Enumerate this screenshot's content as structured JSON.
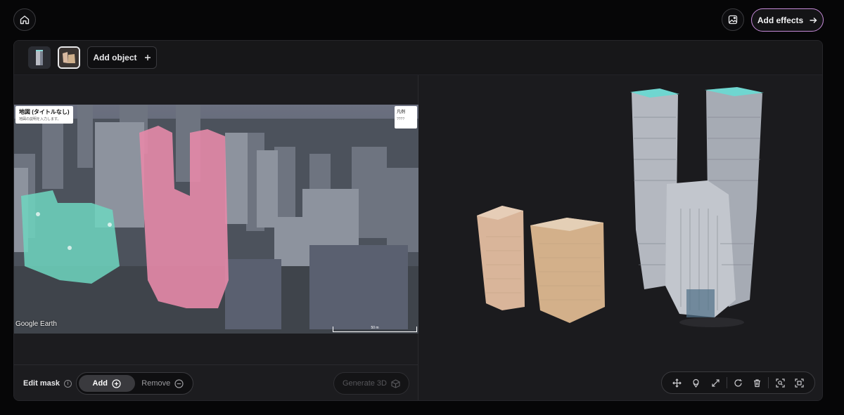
{
  "header": {
    "home_icon": "home-icon",
    "gallery_icon": "image-icon",
    "add_effects_label": "Add effects",
    "add_effects_icon": "arrow-right-icon"
  },
  "object_bar": {
    "thumbnails": [
      {
        "name": "building-thumb-1",
        "selected": false
      },
      {
        "name": "building-thumb-2",
        "selected": true
      }
    ],
    "add_object_label": "Add object",
    "add_object_icon": "plus-icon"
  },
  "map": {
    "title": "地図 (タイトルなし)",
    "subtitle": "地図の説明を入力します。",
    "legend_title": "凡例",
    "legend_item": "????",
    "attribution": "Google Earth",
    "scale_label": "50 m"
  },
  "edit_bar": {
    "label": "Edit mask",
    "info_icon": "info-icon",
    "modes": [
      {
        "label": "Add",
        "icon": "plus-circle-icon",
        "active": true
      },
      {
        "label": "Remove",
        "icon": "minus-circle-icon",
        "active": false
      }
    ],
    "generate_label": "Generate 3D",
    "generate_icon": "cube-icon"
  },
  "toolbar": {
    "tools": [
      "move-icon",
      "material-icon",
      "scale-icon",
      "rotate-icon",
      "trash-icon",
      "focus-icon",
      "frame-icon"
    ]
  },
  "colors": {
    "accent_border": "#c58ad8",
    "mask_pink": "#e58aa8",
    "mask_teal": "#6fd6c0"
  }
}
